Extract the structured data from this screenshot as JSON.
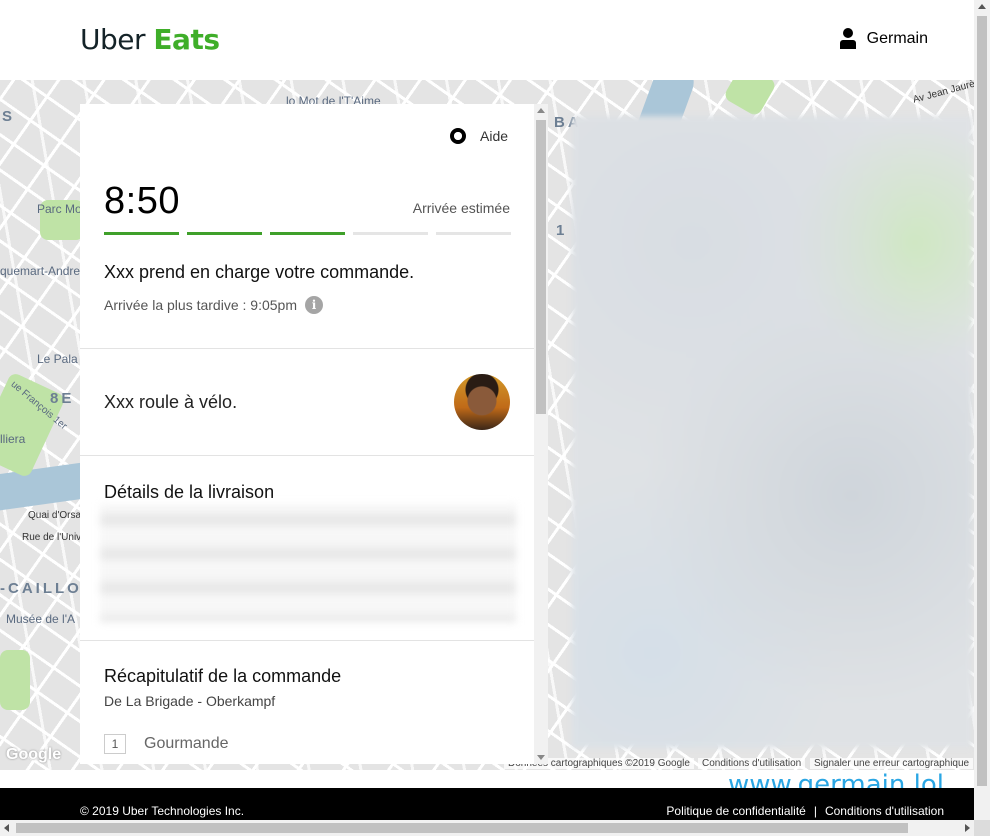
{
  "header": {
    "logo_uber": "Uber",
    "logo_eats": "Eats",
    "user_name": "Germain"
  },
  "help": {
    "label": "Aide"
  },
  "eta": {
    "time": "8:50",
    "label": "Arrivée estimée",
    "progress_steps_total": 5,
    "progress_steps_done": 3
  },
  "status": {
    "main": "Xxx prend en charge votre commande.",
    "latest_arrival": "Arrivée la plus tardive : 9:05pm",
    "info_icon": "i"
  },
  "courier": {
    "text": "Xxx roule à vélo."
  },
  "delivery": {
    "title": "Détails de la livraison"
  },
  "order": {
    "title": "Récapitulatif de la commande",
    "restaurant": "De La Brigade - Oberkampf",
    "items": [
      {
        "qty": "1",
        "name": "Gourmande"
      }
    ]
  },
  "map": {
    "labels": {
      "l1": "Parc Mo",
      "l2": "quemart-Andre",
      "l3": "Le Pala",
      "l4": "8E",
      "l5": "Franklin",
      "l6": "Quai d'Orsay",
      "l7": "Rue de l'Unive",
      "l8": "-CAILLOU",
      "l9": "Musée de l'A",
      "l10": "ue François 1er",
      "l11": "lliera",
      "l12": "lo Mot de l'T'Aime",
      "l13": "Av Jean Jaurès",
      "l14": "S",
      "l15": "BA",
      "l16": "1"
    },
    "google": "Google",
    "footer_data": "Données cartographiques ©2019 Google",
    "footer_terms": "Conditions d'utilisation",
    "footer_report": "Signaler une erreur cartographique"
  },
  "watermark": "www.germain.lol",
  "footer": {
    "copyright": "© 2019 Uber Technologies Inc.",
    "privacy": "Politique de confidentialité",
    "separator": "|",
    "terms": "Conditions d'utilisation"
  },
  "colors": {
    "brand_green": "#3fae29",
    "progress_green": "#3fa02a"
  }
}
